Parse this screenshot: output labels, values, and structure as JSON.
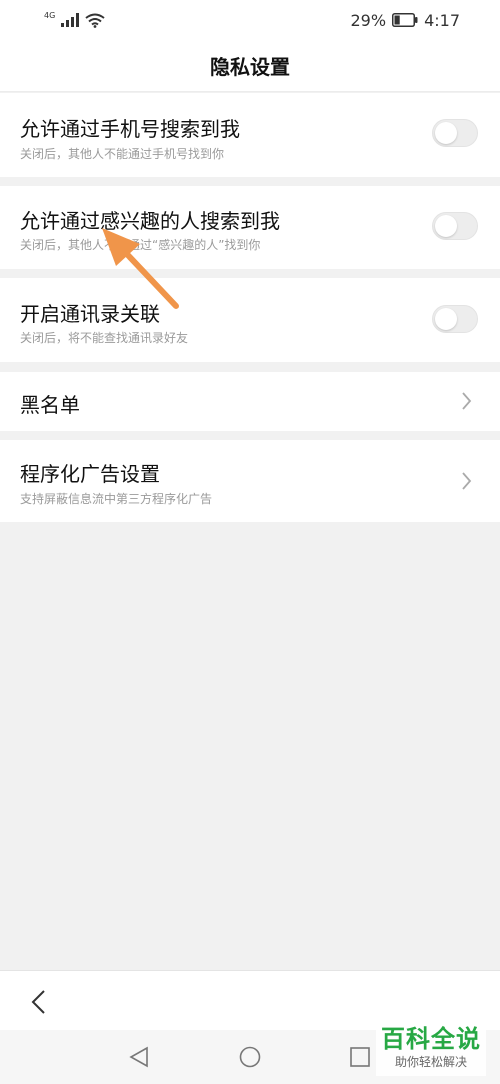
{
  "status_bar": {
    "network": "4G",
    "battery_percent": "29%",
    "battery_level": 0.29,
    "time": "4:17",
    "icons": [
      "signal-icon",
      "wifi-icon",
      "battery-icon"
    ]
  },
  "header": {
    "title": "隐私设置"
  },
  "settings": [
    {
      "title": "允许通过手机号搜索到我",
      "subtitle": "关闭后，其他人不能通过手机号找到你",
      "control": "toggle",
      "enabled": false
    },
    {
      "title": "允许通过感兴趣的人搜索到我",
      "subtitle": "关闭后，其他人不能通过“感兴趣的人”找到你",
      "control": "toggle",
      "enabled": false
    },
    {
      "title": "开启通讯录关联",
      "subtitle": "关闭后，将不能查找通讯录好友",
      "control": "toggle",
      "enabled": false
    },
    {
      "title": "黑名单",
      "control": "chevron"
    },
    {
      "title": "程序化广告设置",
      "subtitle": "支持屏蔽信息流中第三方程序化广告",
      "control": "chevron"
    }
  ],
  "watermark": {
    "title": "百科全说",
    "subtitle": "助你轻松解决"
  },
  "colors": {
    "accent_arrow": "#f0954a",
    "watermark_green": "#27a844",
    "toggle_off": "#ededed",
    "background": "#f1f1f1"
  }
}
